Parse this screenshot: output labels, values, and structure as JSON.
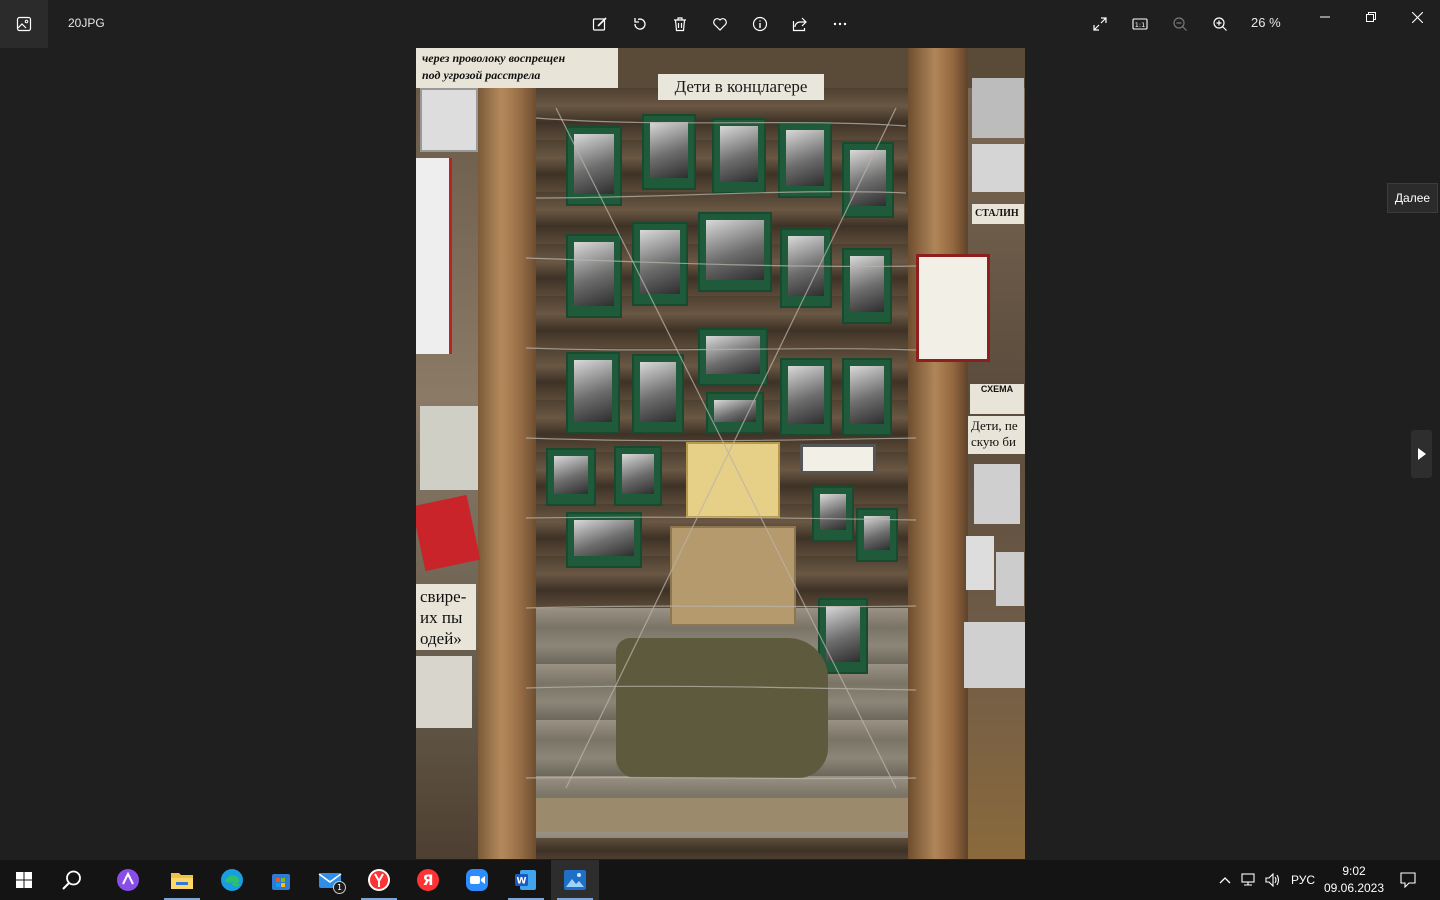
{
  "window": {
    "filename": "20JPG",
    "zoom": "26 %",
    "tooltip": "Далее"
  },
  "toolbar": {
    "edit_icon": "edit-icon",
    "rotate_icon": "rotate-icon",
    "delete_icon": "trash-icon",
    "favorite_icon": "heart-icon",
    "info_icon": "info-icon",
    "share_icon": "share-icon",
    "more_icon": "more-icon"
  },
  "photo": {
    "sign_line1": "через проволоку воспрещен",
    "sign_line2": "под угрозой расстрела",
    "exhibit_title": "Дети в концлагере",
    "left_text": "свире-\nих пы\nодей»",
    "right_text": "Дети, пе\nскую би",
    "schema_label": "СХЕМА",
    "stalin_label": "СТАЛИН"
  },
  "taskbar": {
    "apps": [
      "start",
      "search",
      "alice",
      "file-explorer",
      "edge",
      "store",
      "mail",
      "yandex-browser",
      "yandex",
      "zoom",
      "word",
      "photos"
    ],
    "mail_badge": "1",
    "language": "РУС",
    "time": "9:02",
    "date": "09.06.2023"
  },
  "colors": {
    "background": "#1f1f1f",
    "taskbar": "#141414",
    "accent": "#7aa7d6"
  }
}
